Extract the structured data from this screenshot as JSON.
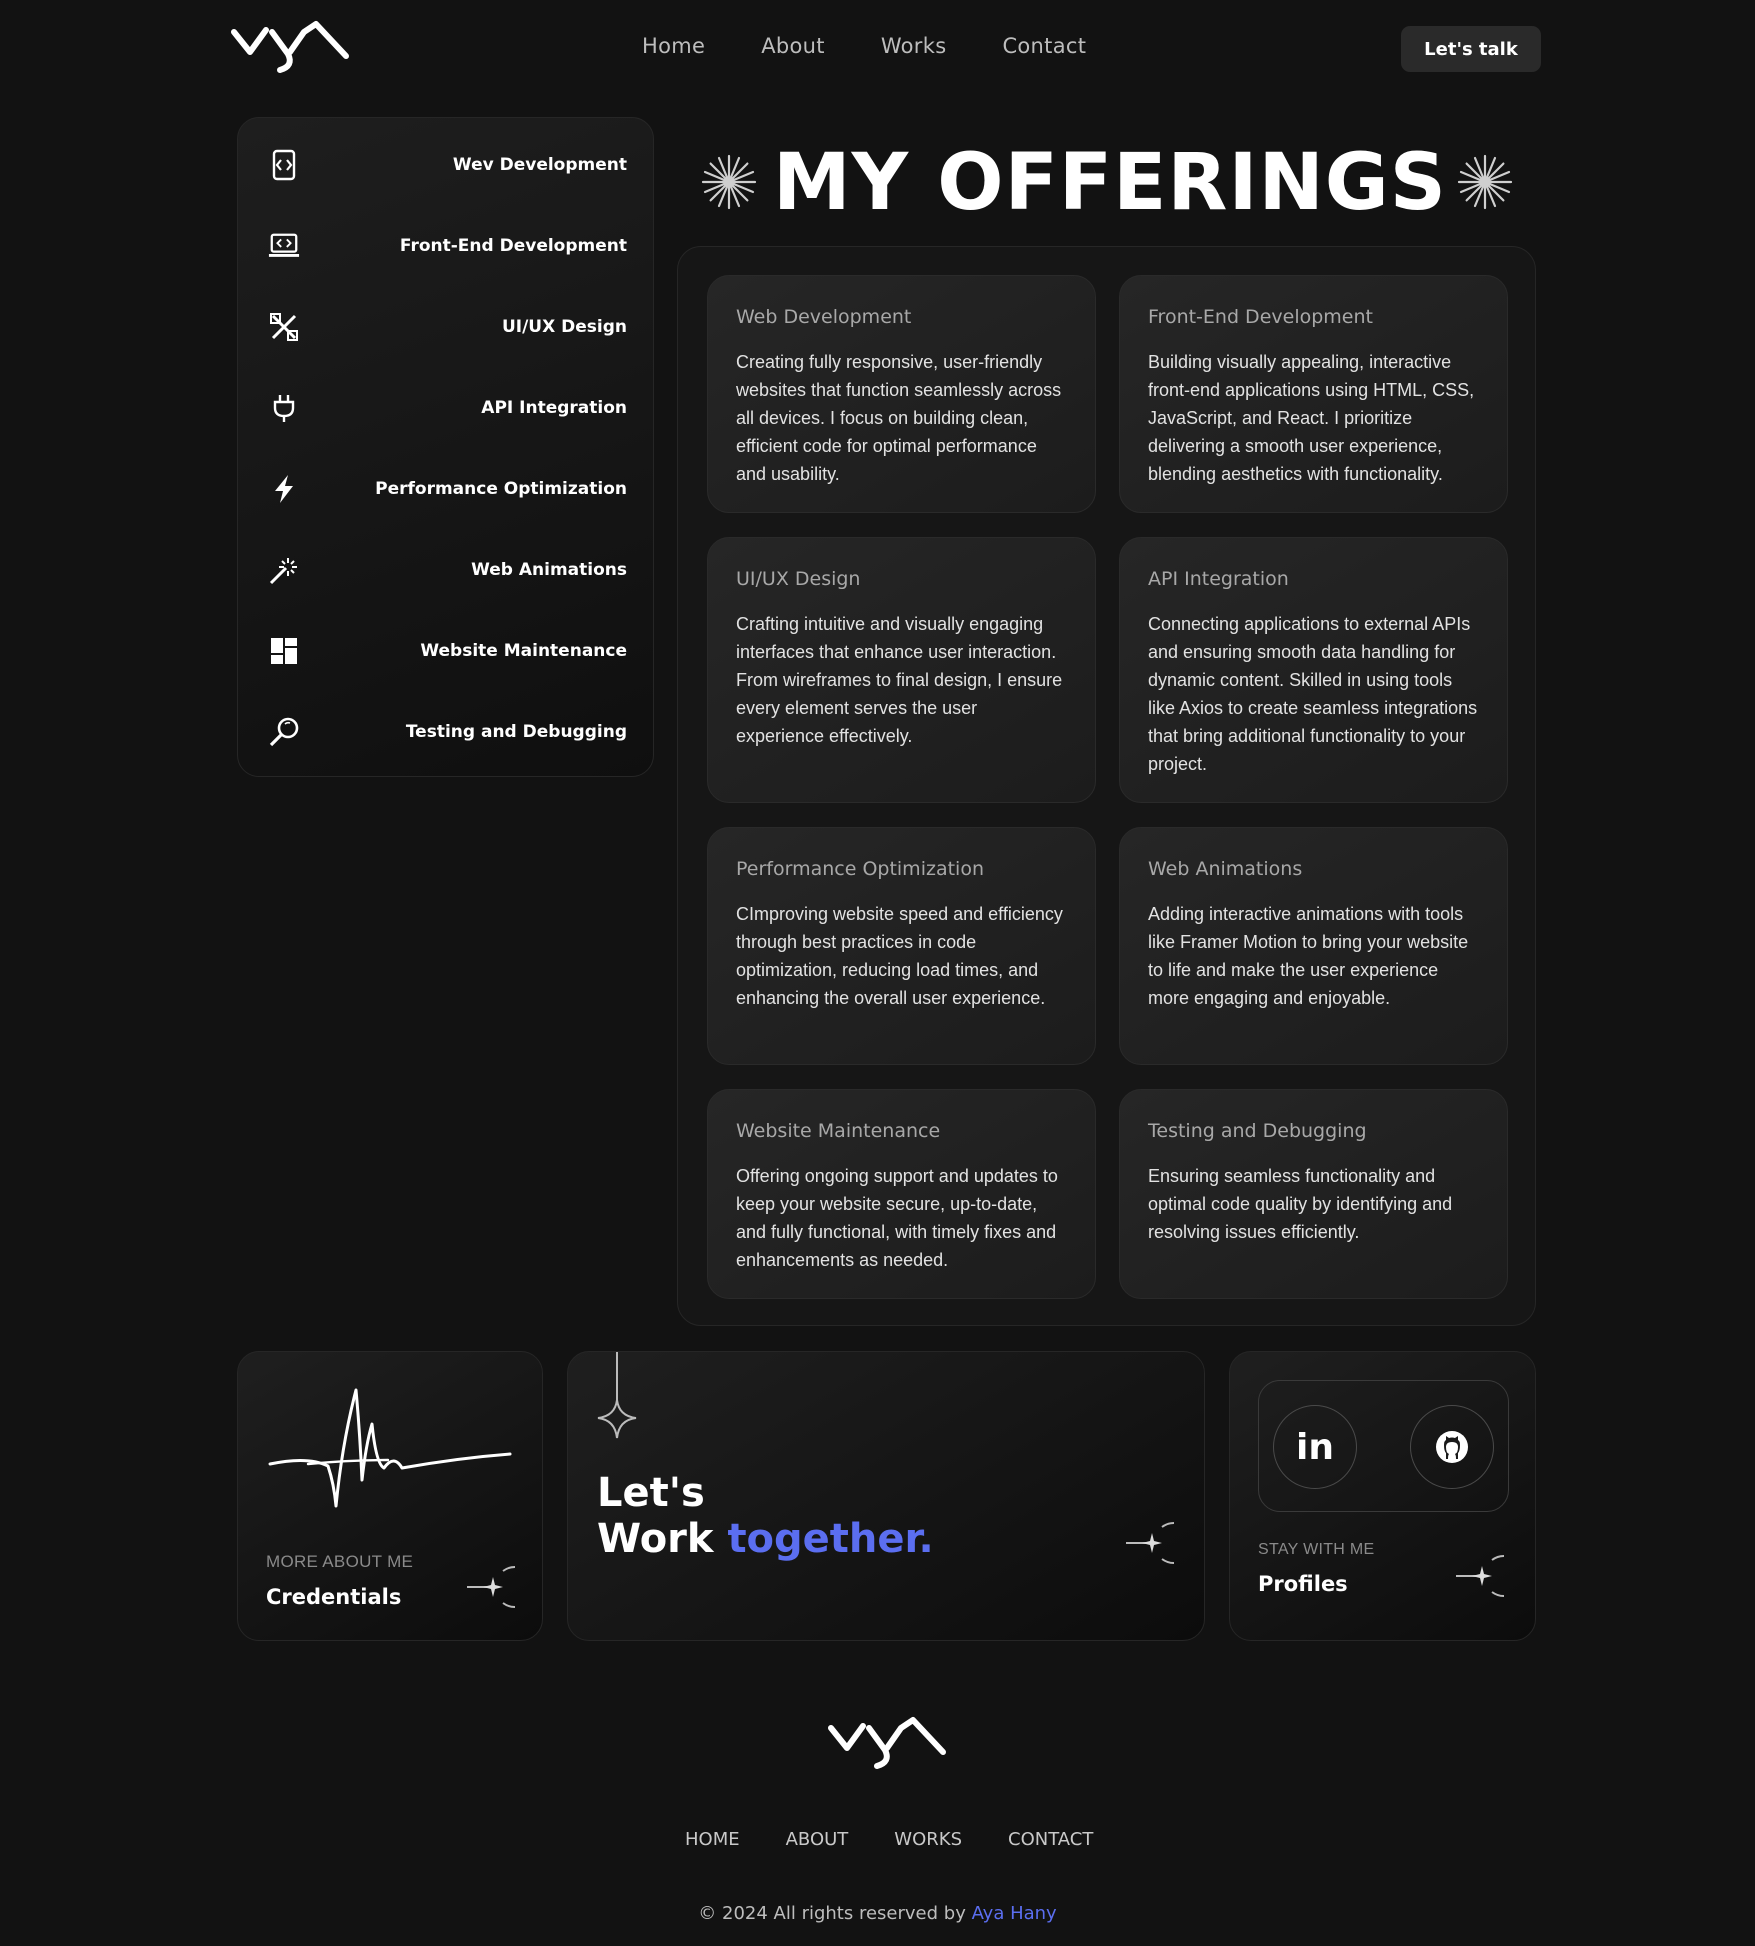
{
  "header": {
    "logo_alt": "aya logo",
    "nav": [
      "Home",
      "About",
      "Works",
      "Contact"
    ],
    "cta_label": "Let's talk"
  },
  "sidebar": {
    "items": [
      {
        "label": "Wev Development",
        "icon": "code-phone-icon"
      },
      {
        "label": "Front-End Development",
        "icon": "laptop-code-icon"
      },
      {
        "label": "UI/UX Design",
        "icon": "design-tools-icon"
      },
      {
        "label": "API Integration",
        "icon": "plug-icon"
      },
      {
        "label": "Performance Optimization",
        "icon": "lightning-icon"
      },
      {
        "label": "Web Animations",
        "icon": "magic-wand-icon"
      },
      {
        "label": "Website Maintenance",
        "icon": "dashboard-grid-icon"
      },
      {
        "label": "Testing and Debugging",
        "icon": "magnifier-icon"
      }
    ]
  },
  "main": {
    "title": "MY OFFERINGS",
    "offerings": [
      {
        "title": "Web Development",
        "desc": "Creating fully responsive, user-friendly websites that function seamlessly across all devices. I focus on building clean, efficient code for optimal performance and usability."
      },
      {
        "title": "Front-End Development",
        "desc": "Building visually appealing, interactive front-end applications using HTML, CSS, JavaScript, and React. I prioritize delivering a smooth user experience, blending aesthetics with functionality."
      },
      {
        "title": "UI/UX Design",
        "desc": "Crafting intuitive and visually engaging interfaces that enhance user interaction. From wireframes to final design, I ensure every element serves the user experience effectively."
      },
      {
        "title": "API Integration",
        "desc": "Connecting applications to external APIs and ensuring smooth data handling for dynamic content. Skilled in using tools like Axios to create seamless integrations that bring additional functionality to your project."
      },
      {
        "title": "Performance Optimization",
        "desc": "CImproving website speed and efficiency through best practices in code optimization, reducing load times, and enhancing the overall user experience."
      },
      {
        "title": "Web Animations",
        "desc": "Adding interactive animations with tools like Framer Motion to bring your website to life and make the user experience more engaging and enjoyable."
      },
      {
        "title": "Website Maintenance",
        "desc": "Offering ongoing support and updates to keep your website secure, up-to-date, and fully functional, with timely fixes and enhancements as needed."
      },
      {
        "title": "Testing and Debugging",
        "desc": "Ensuring seamless functionality and optimal code quality by identifying and resolving issues efficiently."
      }
    ]
  },
  "bottom": {
    "credentials": {
      "caption": "MORE ABOUT ME",
      "label": "Credentials"
    },
    "work": {
      "line1": "Let's",
      "line2_plain": "Work ",
      "line2_accent": "together."
    },
    "profiles": {
      "caption": "STAY WITH ME",
      "label": "Profiles",
      "linkedin": "in"
    }
  },
  "footer": {
    "nav": [
      "HOME",
      "ABOUT",
      "WORKS",
      "CONTACT"
    ],
    "copyright_prefix": "© 2024 All rights reserved by ",
    "copyright_name": "Aya Hany"
  },
  "colors": {
    "background": "#121212",
    "accent": "#5b6ef0",
    "card": "#242424"
  }
}
